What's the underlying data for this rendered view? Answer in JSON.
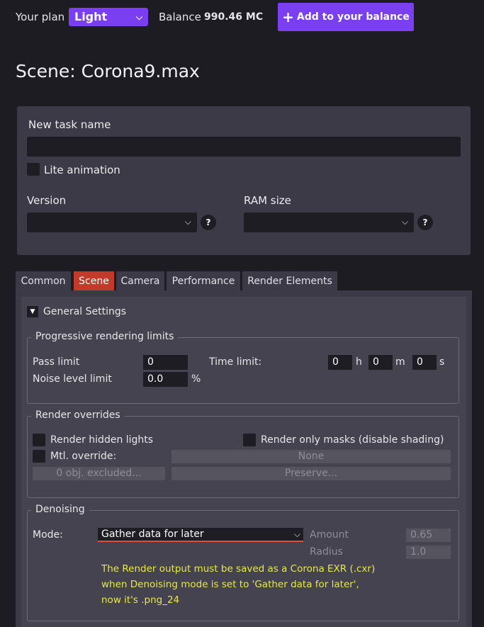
{
  "topbar": {
    "plan_label": "Your plan",
    "plan_value": "Light",
    "balance_label": "Balance",
    "balance_value": "990.46 MC",
    "add_balance_label": "Add to your balance"
  },
  "scene": {
    "title": "Scene: Corona9.max"
  },
  "task": {
    "name_label": "New task name",
    "name_value": "",
    "lite_animation_label": "Lite animation",
    "version_label": "Version",
    "ram_label": "RAM size",
    "help_glyph": "?"
  },
  "tabs": [
    {
      "label": "Common"
    },
    {
      "label": "Scene",
      "active": true
    },
    {
      "label": "Camera"
    },
    {
      "label": "Performance"
    },
    {
      "label": "Render Elements"
    }
  ],
  "general": {
    "label": "General Settings"
  },
  "progressive": {
    "legend": "Progressive rendering limits",
    "pass_limit_label": "Pass limit",
    "pass_limit_value": "0",
    "time_limit_label": "Time limit:",
    "hours_value": "0",
    "hours_unit": "h",
    "minutes_value": "0",
    "minutes_unit": "m",
    "seconds_value": "0",
    "seconds_unit": "s",
    "noise_label": "Noise level limit",
    "noise_value": "0.0",
    "noise_unit": "%"
  },
  "overrides": {
    "legend": "Render overrides",
    "hidden_lights_label": "Render hidden lights",
    "only_masks_label": "Render only masks (disable shading)",
    "mtl_override_label": "Mtl. override:",
    "mtl_value": "None",
    "excluded_label": "0 obj. excluded...",
    "preserve_label": "Preserve..."
  },
  "denoising": {
    "legend": "Denoising",
    "mode_label": "Mode:",
    "mode_value": "Gather data for later",
    "amount_label": "Amount",
    "amount_value": "0.65",
    "radius_label": "Radius",
    "radius_value": "1.0",
    "warning_line1": "The Render output must be saved as a Corona EXR (.cxr)",
    "warning_line2": "when Denoising mode is set to 'Gather data for later',",
    "warning_line3": "now it's .png_24"
  },
  "colors": {
    "accent": "#7b3ff2",
    "active_tab": "#c23a2a",
    "warning": "#e8e84a",
    "background": "#1d1c22",
    "panel": "#3b3a46"
  }
}
